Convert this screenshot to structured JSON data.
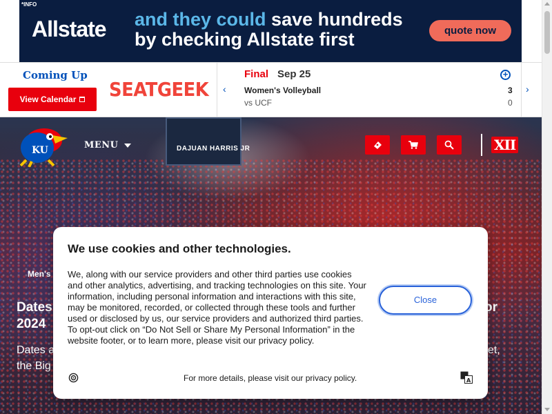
{
  "ad": {
    "info_label": "INFO",
    "logo": "Allstate",
    "headline_highlight": "and they could",
    "headline_rest": "save hundreds",
    "headline_line2": "by checking Allstate first",
    "cta": "quote now",
    "colors": {
      "background": "#0a1d40",
      "highlight": "#5bb7e8",
      "cta": "#f06b5a"
    }
  },
  "scores_bar": {
    "coming_up": "Coming Up",
    "view_calendar": "View Calendar",
    "sponsor": "SEATGEEK",
    "game": {
      "status": "Final",
      "date": "Sep 25",
      "team": "Women's Volleyball",
      "team_score": "3",
      "opponent": "vs UCF",
      "opponent_score": "0"
    }
  },
  "hero": {
    "menu_label": "MENU",
    "scoreboard_text": "DAJUAN HARRIS JR",
    "conference_logo": "XII",
    "category": "Men's",
    "title_left": "Dates",
    "title_right": "or",
    "title_line2": "2024",
    "desc_line1_left": "Dates a",
    "desc_line1_right": "eset,",
    "desc_line2_left": "the Big 1",
    "colors": {
      "accent": "#e8000d",
      "brand_blue": "#0051ba"
    }
  },
  "cookie": {
    "title": "We use cookies and other technologies.",
    "body": "We, along with our service providers and other third parties use cookies and other analytics, advertising, and tracking technologies on this site. Your information, including personal information and interactions with this site, may be monitored, recorded, or collected through these tools and further used or disclosed by us, our service providers and authorized third parties. To opt-out click on “Do Not Sell or Share My Personal Information” in the website footer, or to learn more, please visit our privacy policy.",
    "close_label": "Close",
    "footer": "For more details, please visit our privacy policy."
  }
}
